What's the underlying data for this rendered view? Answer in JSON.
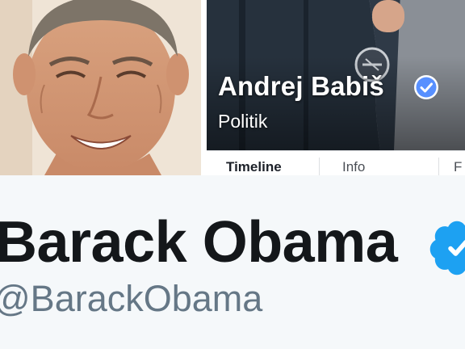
{
  "facebook": {
    "name": "Andrej Babiš",
    "category": "Politik",
    "tabs": [
      "Timeline",
      "Info",
      "F"
    ],
    "verified_icon": "verified-badge-icon"
  },
  "twitter": {
    "name": "Barack Obama",
    "handle": "@BarackObama",
    "verified_icon": "verified-badge-icon"
  },
  "colors": {
    "facebook_verified": "#5890ff",
    "twitter_verified": "#1da1f2",
    "twitter_background": "#f5f8fa",
    "handle_gray": "#657786"
  }
}
